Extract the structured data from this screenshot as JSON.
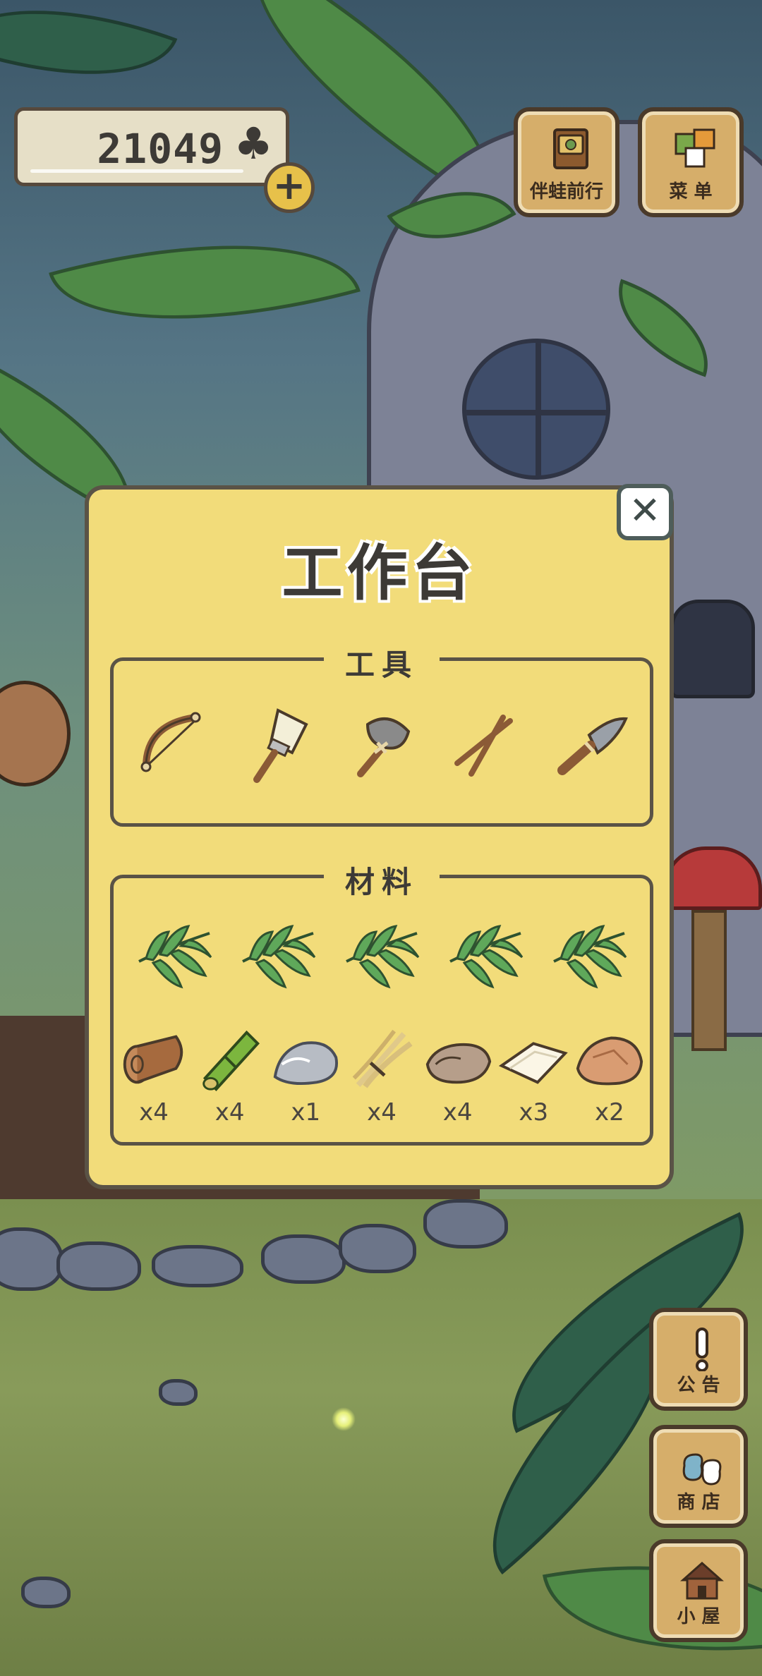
{
  "hud": {
    "clover_count": "21049",
    "clover_symbol": "♣",
    "plus_symbol": "+",
    "travel_label": "伴蛙前行",
    "menu_label": "菜 单"
  },
  "side_menu": {
    "notice_label": "公 告",
    "shop_label": "商 店",
    "house_label": "小 屋"
  },
  "workbench": {
    "title": "工作台",
    "close_symbol": "✕",
    "tools_label": "工具",
    "materials_label": "材料",
    "tools": [
      "bow-icon",
      "brush-icon",
      "stone-axe-icon",
      "sticks-icon",
      "knife-icon"
    ],
    "leaves": [
      "palm-leaf-icon",
      "palm-leaf-icon",
      "palm-leaf-icon",
      "palm-leaf-icon",
      "palm-leaf-icon"
    ],
    "materials": [
      {
        "icon": "log-icon",
        "qty": "x4"
      },
      {
        "icon": "bamboo-icon",
        "qty": "x4"
      },
      {
        "icon": "stone-icon",
        "qty": "x1"
      },
      {
        "icon": "straw-icon",
        "qty": "x4"
      },
      {
        "icon": "hide-icon",
        "qty": "x4"
      },
      {
        "icon": "paper-icon",
        "qty": "x3"
      },
      {
        "icon": "clay-icon",
        "qty": "x2"
      }
    ]
  },
  "colors": {
    "panel": "#f2dc7a",
    "panel_border": "#5a5346",
    "wood_button": "#d6ae6a"
  }
}
